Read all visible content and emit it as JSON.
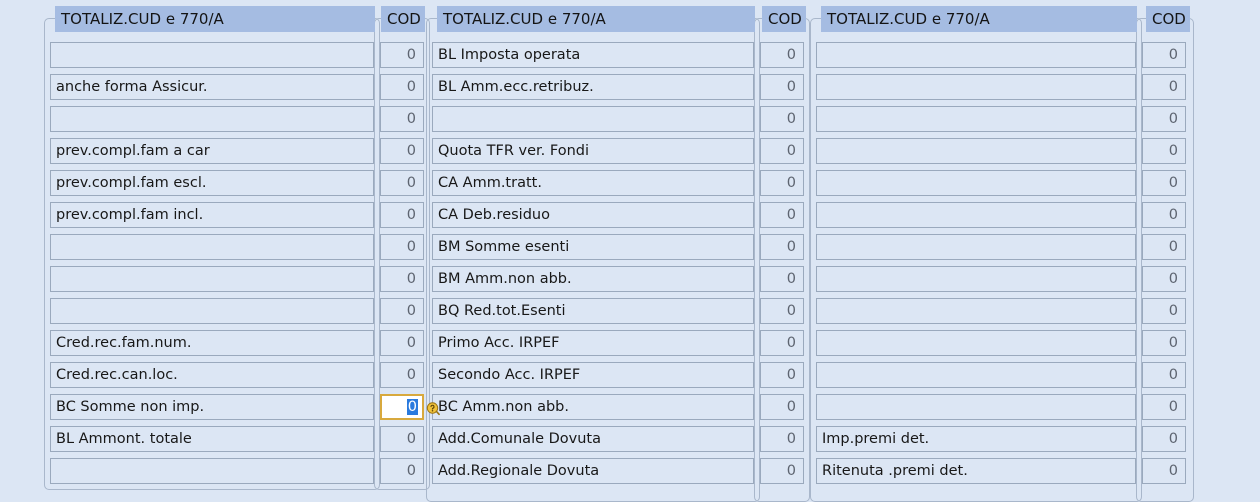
{
  "window": {
    "title": "TOTALIZ.CUD e 770/A",
    "background_color": "#dce6f4",
    "caption_color": "#a5bce2",
    "focus_border_color": "#d8a93d",
    "selection_color": "#2a7ade"
  },
  "panels": [
    {
      "id": "panel-1",
      "label_caption": "TOTALIZ.CUD e 770/A",
      "code_caption": "COD",
      "rows": [
        {
          "label": "",
          "code": "0"
        },
        {
          "label": "anche forma Assicur.",
          "code": "0"
        },
        {
          "label": "",
          "code": "0"
        },
        {
          "label": "prev.compl.fam a car",
          "code": "0"
        },
        {
          "label": "prev.compl.fam escl.",
          "code": "0"
        },
        {
          "label": "prev.compl.fam incl.",
          "code": "0"
        },
        {
          "label": "",
          "code": "0"
        },
        {
          "label": "",
          "code": "0"
        },
        {
          "label": "",
          "code": "0"
        },
        {
          "label": "Cred.rec.fam.num.",
          "code": "0"
        },
        {
          "label": "Cred.rec.can.loc.",
          "code": "0"
        },
        {
          "label": "BC Somme non imp.",
          "code": "0",
          "focused": true
        },
        {
          "label": "BL Ammont. totale",
          "code": "0"
        },
        {
          "label": "",
          "code": "0"
        }
      ]
    },
    {
      "id": "panel-2",
      "label_caption": "TOTALIZ.CUD e 770/A",
      "code_caption": "COD",
      "rows": [
        {
          "label": "BL Imposta operata",
          "code": "0"
        },
        {
          "label": "BL Amm.ecc.retribuz.",
          "code": "0"
        },
        {
          "label": "",
          "code": "0"
        },
        {
          "label": "Quota TFR ver. Fondi",
          "code": "0"
        },
        {
          "label": "CA Amm.tratt.",
          "code": "0"
        },
        {
          "label": "CA Deb.residuo",
          "code": "0"
        },
        {
          "label": "BM Somme esenti",
          "code": "0"
        },
        {
          "label": "BM Amm.non abb.",
          "code": "0"
        },
        {
          "label": "BQ Red.tot.Esenti",
          "code": "0"
        },
        {
          "label": "Primo Acc. IRPEF",
          "code": "0"
        },
        {
          "label": "Secondo Acc. IRPEF",
          "code": "0"
        },
        {
          "label": "BC Amm.non abb.",
          "code": "0"
        },
        {
          "label": "Add.Comunale Dovuta",
          "code": "0"
        },
        {
          "label": "Add.Regionale Dovuta",
          "code": "0"
        }
      ]
    },
    {
      "id": "panel-3",
      "label_caption": "TOTALIZ.CUD e 770/A",
      "code_caption": "COD",
      "rows": [
        {
          "label": "",
          "code": "0"
        },
        {
          "label": "",
          "code": "0"
        },
        {
          "label": "",
          "code": "0"
        },
        {
          "label": "",
          "code": "0"
        },
        {
          "label": "",
          "code": "0"
        },
        {
          "label": "",
          "code": "0"
        },
        {
          "label": "",
          "code": "0"
        },
        {
          "label": "",
          "code": "0"
        },
        {
          "label": "",
          "code": "0"
        },
        {
          "label": "",
          "code": "0"
        },
        {
          "label": "",
          "code": "0"
        },
        {
          "label": "",
          "code": "0"
        },
        {
          "label": "Imp.premi det.",
          "code": "0"
        },
        {
          "label": "Ritenuta .premi det.",
          "code": "0"
        }
      ]
    }
  ],
  "icons": {
    "help_bubble": "help-bubble-icon"
  }
}
